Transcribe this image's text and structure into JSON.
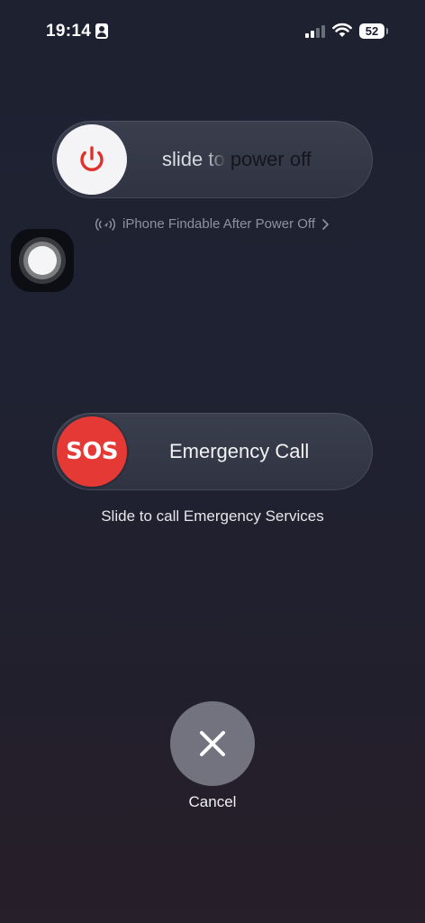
{
  "status_bar": {
    "time": "19:14",
    "battery_level": "52",
    "icons": [
      "contact-icon",
      "signal-icon",
      "wifi-icon",
      "battery-icon"
    ]
  },
  "power_slider": {
    "label": "slide to power off",
    "knob_icon": "power-icon",
    "knob_icon_color": "#e0302a"
  },
  "findable": {
    "text": "iPhone Findable After Power Off",
    "icon": "find-my-signal-icon",
    "chevron_icon": "chevron-right-icon"
  },
  "assistive_touch": {
    "icon": "assistive-touch-icon"
  },
  "sos_slider": {
    "knob_label": "SOS",
    "label": "Emergency Call",
    "caption": "Slide to call Emergency Services",
    "knob_color": "#e53935"
  },
  "cancel": {
    "label": "Cancel",
    "icon": "close-icon"
  }
}
